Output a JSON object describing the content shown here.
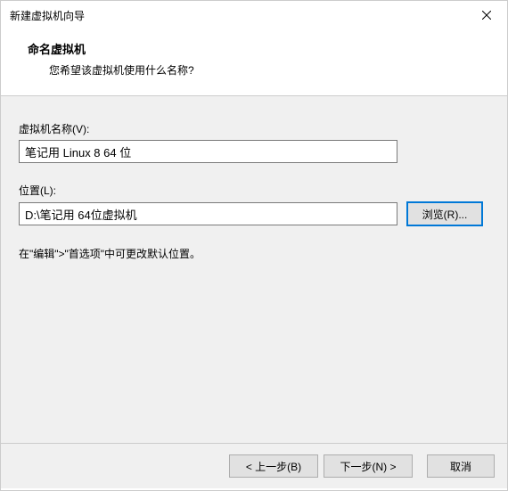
{
  "window": {
    "title": "新建虚拟机向导"
  },
  "header": {
    "title": "命名虚拟机",
    "subtitle": "您希望该虚拟机使用什么名称?"
  },
  "form": {
    "name_label": "虚拟机名称(V):",
    "name_value": "笔记用 Linux 8 64 位",
    "location_label": "位置(L):",
    "location_value": "D:\\笔记用 64位虚拟机",
    "browse_label": "浏览(R)...",
    "hint": "在\"编辑\">\"首选项\"中可更改默认位置。"
  },
  "footer": {
    "back": "< 上一步(B)",
    "next": "下一步(N) >",
    "cancel": "取消"
  }
}
